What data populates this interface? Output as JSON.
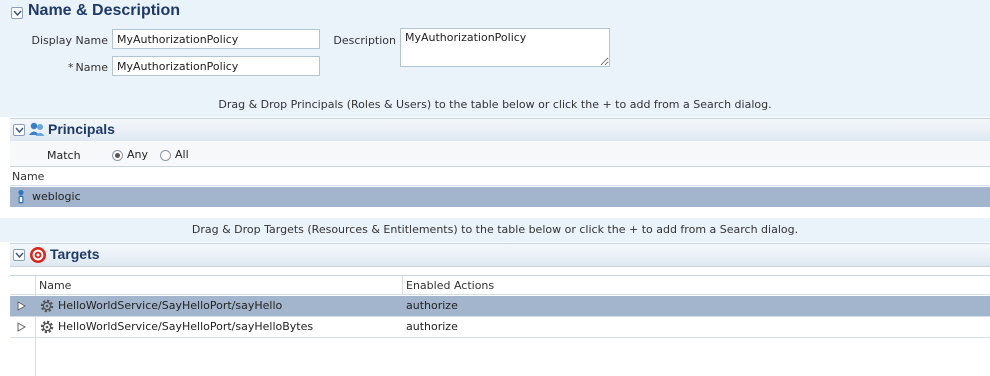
{
  "name_description": {
    "title": "Name & Description",
    "display_name_label": "Display Name",
    "display_name_value": "MyAuthorizationPolicy",
    "name_label": "Name",
    "name_required_mark": "*",
    "name_value": "MyAuthorizationPolicy",
    "description_label": "Description",
    "description_value": "MyAuthorizationPolicy"
  },
  "principals": {
    "hint": "Drag & Drop Principals (Roles & Users) to the table below or click the + to add from a Search dialog.",
    "title": "Principals",
    "match_label": "Match",
    "match_options": [
      "Any",
      "All"
    ],
    "match_selected": "Any",
    "column_name": "Name",
    "rows": [
      {
        "name": "weblogic",
        "icon": "user-icon",
        "selected": true
      }
    ]
  },
  "targets": {
    "hint": "Drag & Drop Targets (Resources & Entitlements) to the table below or click the + to add from a Search dialog.",
    "title": "Targets",
    "columns": [
      "Name",
      "Enabled Actions"
    ],
    "rows": [
      {
        "name": "HelloWorldService/SayHelloPort/sayHello",
        "actions": "authorize",
        "icon": "gear-icon",
        "selected": true
      },
      {
        "name": "HelloWorldService/SayHelloPort/sayHelloBytes",
        "actions": "authorize",
        "icon": "gear-icon",
        "selected": false
      }
    ]
  },
  "colors": {
    "section_title": "#1f3a68",
    "pale_panel": "#eaf2fa",
    "selected_row": "#a3b5cc",
    "targets_icon": "#d9261c"
  }
}
